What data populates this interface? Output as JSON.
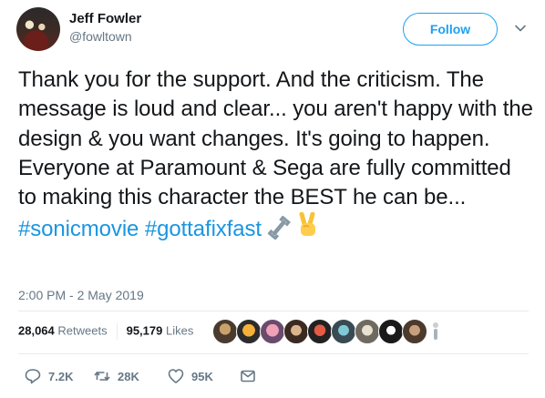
{
  "author": {
    "name": "Jeff Fowler",
    "handle": "@fowltown"
  },
  "header": {
    "follow_label": "Follow",
    "menu_icon": "chevron-down-icon"
  },
  "tweet": {
    "text_plain": "Thank you for the support. And the criticism. The message is loud and clear... you aren't happy with the design & you want changes. It's going to happen. Everyone at Paramount & Sega are fully committed to making this character the BEST he can be... ",
    "hashtag_1": "#sonicmovie",
    "hashtag_2": "#gottafixfast",
    "emojis": [
      "wrench-icon",
      "victory-hand-icon"
    ],
    "timestamp": "2:00 PM - 2 May 2019"
  },
  "stats": {
    "retweets_count": "28,064",
    "retweets_label": "Retweets",
    "likes_count": "95,179",
    "likes_label": "Likes"
  },
  "actions": {
    "replies": "7.2K",
    "retweets": "28K",
    "likes": "95K"
  },
  "colors": {
    "accent": "#1da1f2",
    "hashtag": "#1b95e0",
    "muted": "#657786",
    "text": "#14171a"
  }
}
